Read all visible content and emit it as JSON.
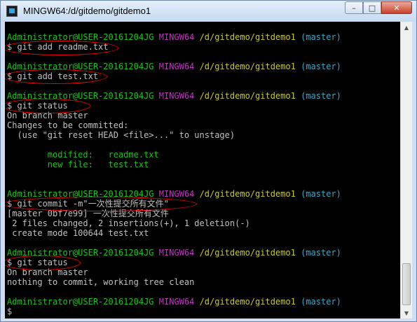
{
  "window": {
    "title": "MINGW64:/d/gitdemo/gitdemo1",
    "controls": {
      "minimize": "–",
      "maximize": "□",
      "close": "✕"
    }
  },
  "terminal": {
    "user": "Administrator@USER-20161204JG",
    "host": "MINGW64",
    "path": "/d/gitdemo/gitdemo1",
    "branch": "(master)",
    "commands": {
      "c1": "$ git add readme.txt",
      "c2": "$ git add test.txt",
      "c3": "$ git status",
      "c4": "$ git commit -m\"一次性提交所有文件\"",
      "c5": "$ git status",
      "prompt": "$"
    },
    "output": {
      "o1": "On branch master",
      "o2": "Changes to be committed:",
      "o3": "  (use \"git reset HEAD <file>...\" to unstage)",
      "o4": "        modified:   readme.txt",
      "o5": "        new file:   test.txt",
      "o6": "[master 0bf7e99] 一次性提交所有文件",
      "o7": " 2 files changed, 2 insertions(+), 1 deletion(-)",
      "o8": " create mode 100644 test.txt",
      "o9": "On branch master",
      "o10": "nothing to commit, working tree clean"
    }
  },
  "colors": {
    "user": "#1cc21c",
    "host": "#c036c0",
    "path": "#c9c920",
    "branch": "#3aa9c9",
    "annotation": "#ff0000"
  }
}
